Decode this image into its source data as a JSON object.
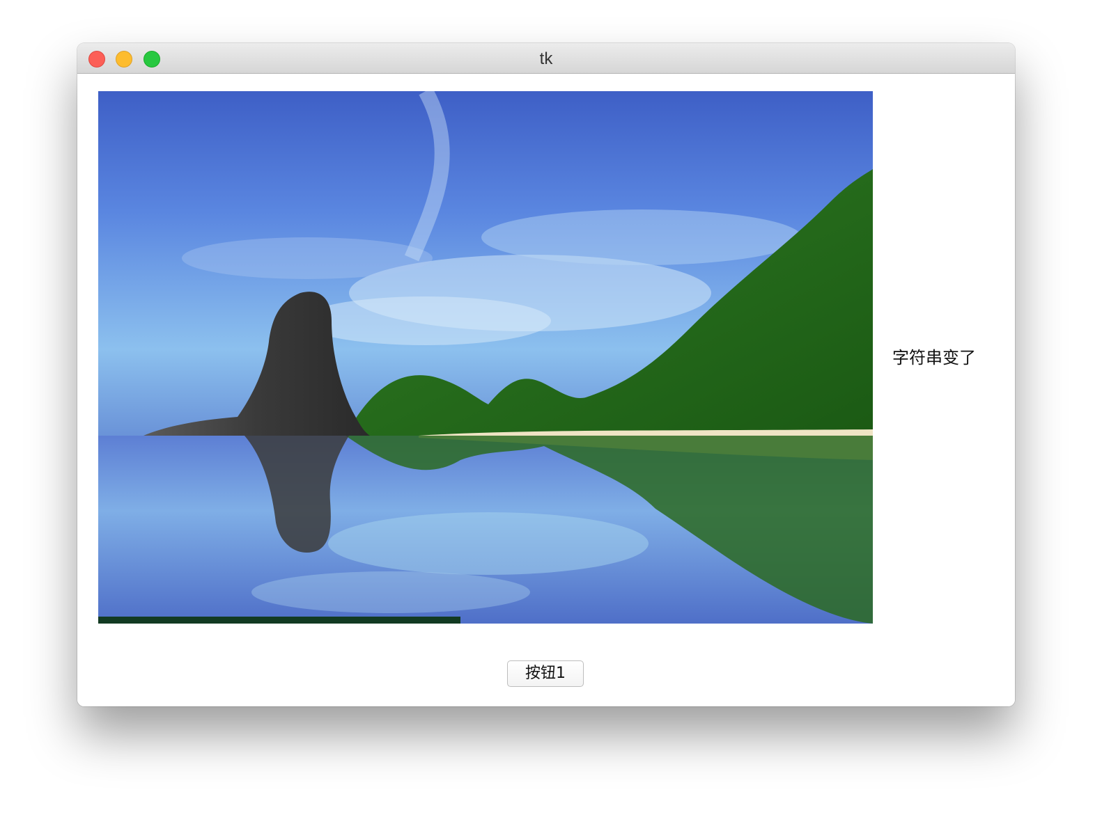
{
  "window": {
    "title": "tk",
    "controls": {
      "close_color": "#fc5f57",
      "minimize_color": "#fdbc2e",
      "zoom_color": "#28c840"
    }
  },
  "main": {
    "image_subject": "landscape-photo",
    "label_text": "字符串变了",
    "button_label": "按钮1"
  }
}
